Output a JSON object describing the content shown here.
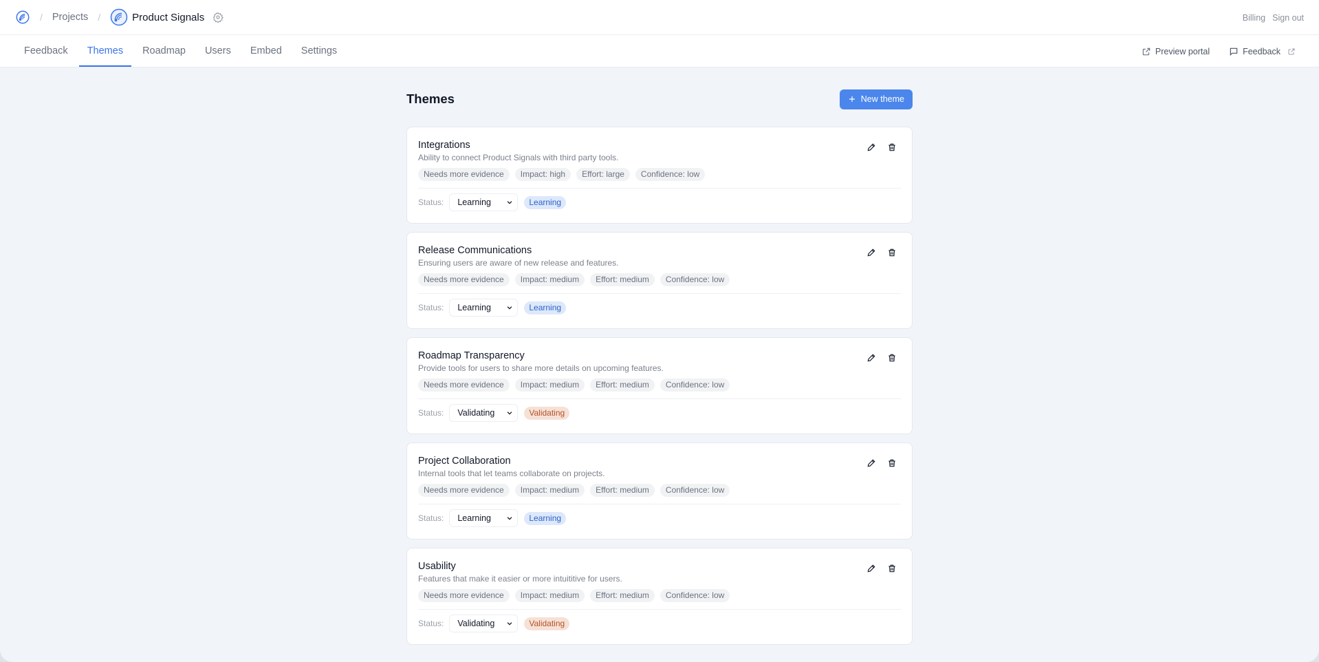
{
  "breadcrumb": {
    "projects_label": "Projects",
    "project_name": "Product Signals",
    "separator": "/"
  },
  "account": {
    "billing": "Billing",
    "sign_out": "Sign out"
  },
  "tabs": [
    {
      "label": "Feedback",
      "active": false
    },
    {
      "label": "Themes",
      "active": true
    },
    {
      "label": "Roadmap",
      "active": false
    },
    {
      "label": "Users",
      "active": false
    },
    {
      "label": "Embed",
      "active": false
    },
    {
      "label": "Settings",
      "active": false
    }
  ],
  "nav_actions": {
    "preview_portal": "Preview portal",
    "feedback": "Feedback"
  },
  "page": {
    "title": "Themes",
    "new_button": "New theme"
  },
  "status_label": "Status:",
  "colors": {
    "accent": "#3b74e8",
    "button": "#4a86ec",
    "learning_bg": "#dde8fb",
    "learning_fg": "#2d63c8",
    "validating_bg": "#f6e1d6",
    "validating_fg": "#b5532a"
  },
  "themes": [
    {
      "title": "Integrations",
      "description": "Ability to connect Product Signals with third party tools.",
      "tags": [
        "Needs more evidence",
        "Impact: high",
        "Effort: large",
        "Confidence: low"
      ],
      "status": "Learning"
    },
    {
      "title": "Release Communications",
      "description": "Ensuring users are aware of new release and features.",
      "tags": [
        "Needs more evidence",
        "Impact: medium",
        "Effort: medium",
        "Confidence: low"
      ],
      "status": "Learning"
    },
    {
      "title": "Roadmap Transparency",
      "description": "Provide tools for users to share more details on upcoming features.",
      "tags": [
        "Needs more evidence",
        "Impact: medium",
        "Effort: medium",
        "Confidence: low"
      ],
      "status": "Validating"
    },
    {
      "title": "Project Collaboration",
      "description": "Internal tools that let teams collaborate on projects.",
      "tags": [
        "Needs more evidence",
        "Impact: medium",
        "Effort: medium",
        "Confidence: low"
      ],
      "status": "Learning"
    },
    {
      "title": "Usability",
      "description": "Features that make it easier or more intuititive for users.",
      "tags": [
        "Needs more evidence",
        "Impact: medium",
        "Effort: medium",
        "Confidence: low"
      ],
      "status": "Validating"
    }
  ]
}
